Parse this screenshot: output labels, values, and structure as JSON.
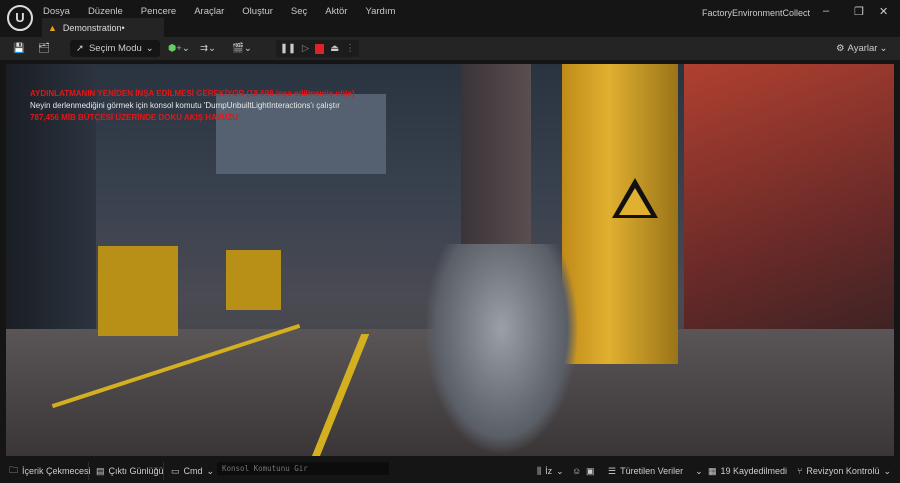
{
  "window": {
    "title": "FactoryEnvironmentCollect",
    "controls": {
      "minimize": "–",
      "maximize": "❐",
      "close": "✕"
    }
  },
  "menu": [
    "Dosya",
    "Düzenle",
    "Pencere",
    "Araçlar",
    "Oluştur",
    "Seç",
    "Aktör",
    "Yardım"
  ],
  "tab": {
    "label": "Demonstration•",
    "icon": "level-icon"
  },
  "toolbar": {
    "mode_label": "Seçim Modu",
    "settings_label": "Ayarlar"
  },
  "viewport": {
    "messages": [
      "AYDINLATMANIN YENİDEN İNŞA EDİLMESİ GEREKİYOR (18 698 inşa edilmemiş obje)",
      "Neyin derlenmediğini görmek için konsol komutu 'DumpUnbuiltLightInteractions'ı çalıştır",
      "787,456 MİB BÜTÇESİ ÜZERİNDE DOKU AKIŞ HAVUZU"
    ]
  },
  "statusbar": {
    "content_drawer": "İçerik Çekmecesi",
    "output_log": "Çıktı Günlüğü",
    "cmd": "Cmd",
    "console_placeholder": "Konsol Komutunu Gir",
    "trace": "İz",
    "derived_data": "Türetilen Veriler",
    "unsaved": "19 Kaydedilmedi",
    "revision_control": "Revizyon Kontrolü"
  },
  "colors": {
    "warning_text": "#e01818",
    "accent": "#f0a020"
  }
}
